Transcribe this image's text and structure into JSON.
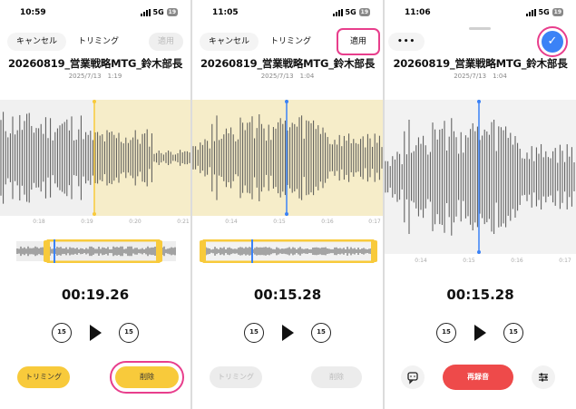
{
  "status": {
    "time_1": "10:59",
    "time_2": "11:05",
    "time_3": "11:06",
    "network": "5G",
    "battery": "19"
  },
  "toolbar": {
    "cancel": "キャンセル",
    "trim_title": "トリミング",
    "apply": "適用",
    "more": "•••",
    "check": "✓"
  },
  "recording": {
    "title": "20260819_営業戦略MTG_鈴木部長",
    "meta_1": "2025/7/13　1:19",
    "meta_2": "2025/7/13　1:04"
  },
  "axis_1": [
    "0:18",
    "0:19",
    "0:20",
    "0:21"
  ],
  "axis_2": [
    "0:14",
    "0:15",
    "0:16",
    "0:17"
  ],
  "axis_3": [
    "0:14",
    "0:15",
    "0:16",
    "0:17"
  ],
  "playback": {
    "time_1": "00:19.26",
    "time_2": "00:15.28",
    "time_3": "00:15.28",
    "skip_back": "15",
    "skip_forward": "15"
  },
  "actions": {
    "trim": "トリミング",
    "delete": "削除",
    "rerecord": "再録音"
  },
  "icons": {
    "speech": "speech-bubble-icon",
    "sliders": "sliders-icon",
    "check": "checkmark-icon",
    "play": "play-icon"
  },
  "colors": {
    "selection": "#f6edc9",
    "accent_yellow": "#f8ca3b",
    "playhead_blue": "#3b82f6",
    "record_red": "#ee4a4a",
    "highlight": "#e83e8c"
  }
}
